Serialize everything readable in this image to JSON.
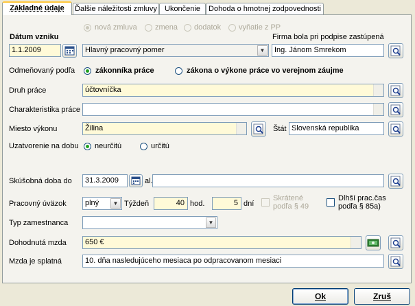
{
  "tabs": [
    {
      "label": "Základné údaje",
      "active": true
    },
    {
      "label": "Ďalšie náležitosti zmluvy"
    },
    {
      "label": "Ukončenie"
    },
    {
      "label": "Dohoda o hmotnej zodpovednosti"
    }
  ],
  "contract_type": {
    "options": [
      "nová zmluva",
      "zmena",
      "dodatok",
      "vyňatie z PP"
    ],
    "selected": "nová zmluva"
  },
  "datum_vzniku": {
    "label": "Dátum vzniku",
    "value": "1.1.2009"
  },
  "pomer": {
    "value": "Hlavný pracovný pomer"
  },
  "firma": {
    "label": "Firma bola pri podpise zastúpená",
    "value": "Ing. Jánom Smrekom"
  },
  "odmenovany": {
    "label": "Odmeňovaný podľa",
    "options": [
      "zákonníka práce",
      "zákona o výkone práce vo verejnom záujme"
    ],
    "selected": "zákonníka práce"
  },
  "druh_prace": {
    "label": "Druh práce",
    "value": "účtovníčka"
  },
  "charakteristika": {
    "label": "Charakteristika práce",
    "value": ""
  },
  "miesto": {
    "label": "Miesto výkonu",
    "value": "Žilina",
    "stat_label": "Štát",
    "stat_value": "Slovenská republika"
  },
  "uzatvorenie": {
    "label": "Uzatvorenie na dobu",
    "options": [
      "neurčitú",
      "určitú"
    ],
    "selected": "neurčitú"
  },
  "skusobna": {
    "label": "Skúšobná doba do",
    "value": "31.3.2009",
    "al_label": "al.",
    "al_value": ""
  },
  "uvazok": {
    "label": "Pracovný úväzok",
    "value": "plný",
    "tyzden_label": "Týždeň",
    "hodiny": "40",
    "hod_label": "hod.",
    "dni": "5",
    "dni_label": "dní",
    "skratene_line1": "Skrátené",
    "skratene_line2": "podľa § 49",
    "dlhsi_line1": "Dlhší prac.čas",
    "dlhsi_line2": "podľa § 85a)"
  },
  "typ_zamestnanca": {
    "label": "Typ zamestnanca",
    "value": ""
  },
  "mzda": {
    "label": "Dohodnutá mzda",
    "value": "650 €"
  },
  "splatnost": {
    "label": "Mzda je splatná",
    "value": "10. dňa nasledujúceho mesiaca po odpracovanom mesiaci"
  },
  "buttons": {
    "ok": "Ok",
    "zrus": "Zruš"
  },
  "colors": {
    "field_yellow": "#FFFAD8",
    "radio_selected": "#21A121",
    "tab_highlight": "#FFC73C"
  }
}
